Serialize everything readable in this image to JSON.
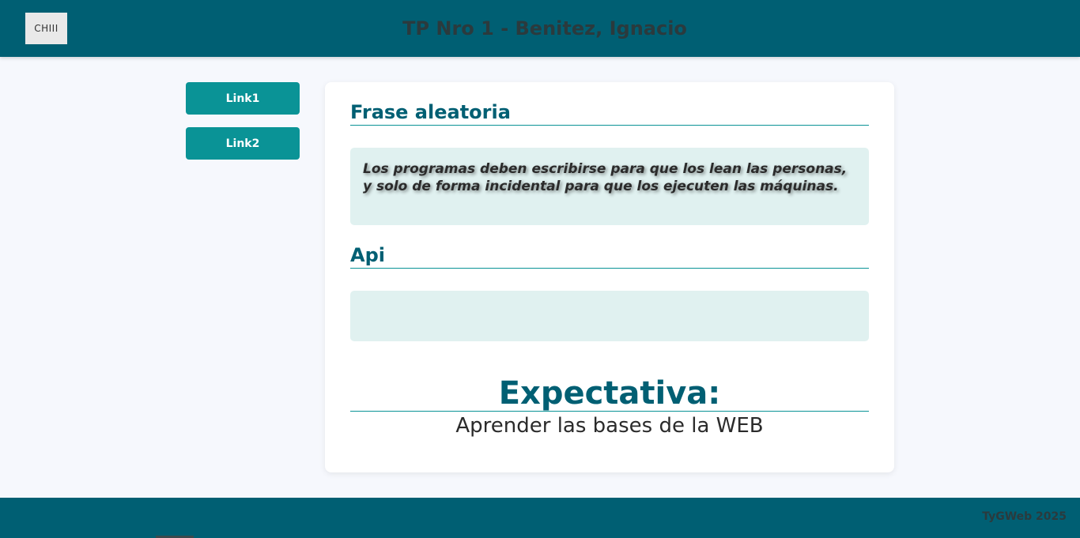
{
  "header": {
    "logo_text": "CHIII",
    "title": "TP Nro 1 - Benitez, Ignacio"
  },
  "sidebar": {
    "links": [
      {
        "label": "Link1"
      },
      {
        "label": "Link2"
      }
    ]
  },
  "main": {
    "quote_section": {
      "title": "Frase aleatoria",
      "quote": "Los programas deben escribirse para que los lean las personas, y solo de forma incidental para que los ejecuten las máquinas."
    },
    "api_section": {
      "title": "Api",
      "content": ""
    },
    "expectation": {
      "title": "Expectativa:",
      "text": "Aprender las bases de la WEB"
    }
  },
  "footer": {
    "text": "TyGWeb 2025"
  },
  "colors": {
    "primary": "#005f73",
    "accent": "#0a9396",
    "box_bg": "#e0f1f0",
    "page_bg": "#f6f8fd"
  }
}
